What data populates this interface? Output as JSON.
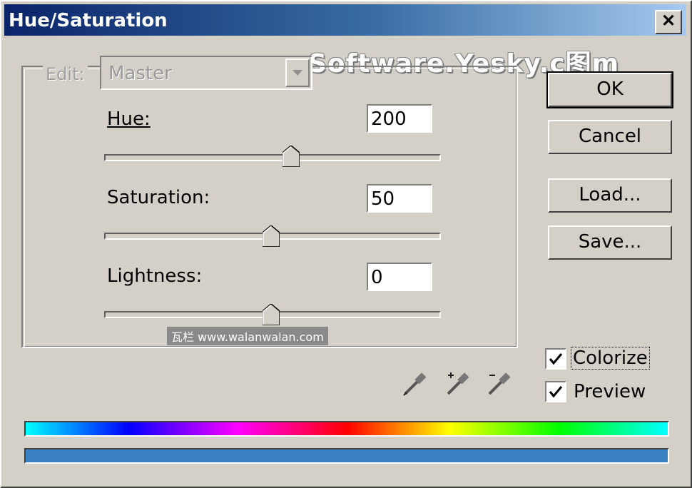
{
  "window": {
    "title": "Hue/Saturation",
    "close_glyph": "✕"
  },
  "watermark": "Software.Yesky.c图m",
  "edit": {
    "label": "Edit:",
    "value": "Master",
    "dropdown_icon": "chevron-down-icon"
  },
  "hue": {
    "label": "Hue:",
    "value": "200",
    "slider_fraction": 0.56
  },
  "saturation": {
    "label": "Saturation:",
    "value": "50",
    "slider_fraction": 0.5
  },
  "lightness": {
    "label": "Lightness:",
    "value": "0",
    "slider_fraction": 0.5
  },
  "buttons": {
    "ok": "OK",
    "cancel": "Cancel",
    "load": "Load...",
    "save": "Save..."
  },
  "colorize": {
    "label": "Colorize",
    "checked": true
  },
  "preview": {
    "label": "Preview",
    "checked": true
  },
  "credit": "瓦栏 www.walanwalan.com",
  "colors": {
    "result_bar": "#3b82c4",
    "title_start": "#0a246a",
    "title_end": "#a6caf0"
  }
}
